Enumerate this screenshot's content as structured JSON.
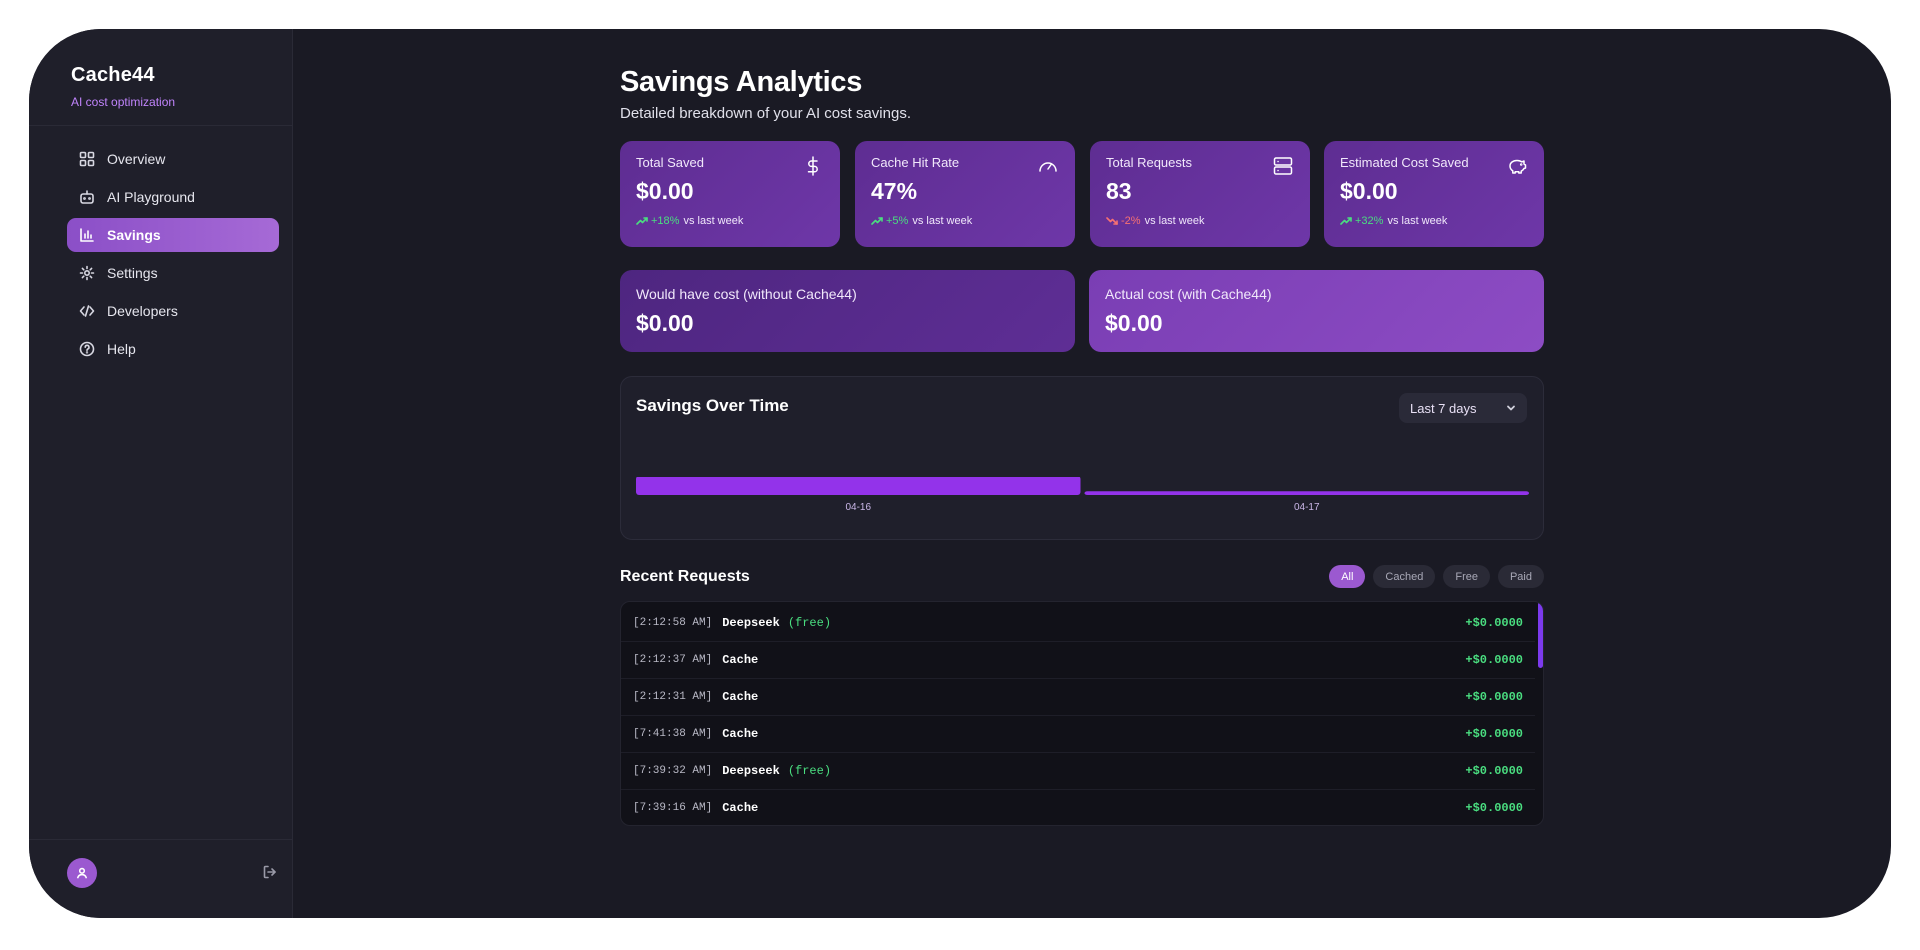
{
  "app": {
    "name": "Cache44",
    "tagline": "AI cost optimization"
  },
  "sidebar": {
    "items": [
      {
        "label": "Overview",
        "icon": "grid-icon",
        "active": false
      },
      {
        "label": "AI Playground",
        "icon": "bot-icon",
        "active": false
      },
      {
        "label": "Savings",
        "icon": "bar-chart-icon",
        "active": true
      },
      {
        "label": "Settings",
        "icon": "gear-icon",
        "active": false
      },
      {
        "label": "Developers",
        "icon": "code-icon",
        "active": false
      },
      {
        "label": "Help",
        "icon": "help-circle-icon",
        "active": false
      }
    ]
  },
  "page": {
    "title": "Savings Analytics",
    "subtitle": "Detailed breakdown of your AI cost savings."
  },
  "stats": [
    {
      "label": "Total Saved",
      "value": "$0.00",
      "trend": "+18%",
      "trend_dir": "up",
      "trend_suffix": "vs last week",
      "icon": "dollar-icon"
    },
    {
      "label": "Cache Hit Rate",
      "value": "47%",
      "trend": "+5%",
      "trend_dir": "up",
      "trend_suffix": "vs last week",
      "icon": "gauge-icon"
    },
    {
      "label": "Total Requests",
      "value": "83",
      "trend": "-2%",
      "trend_dir": "down",
      "trend_suffix": "vs last week",
      "icon": "server-icon"
    },
    {
      "label": "Estimated Cost Saved",
      "value": "$0.00",
      "trend": "+32%",
      "trend_dir": "up",
      "trend_suffix": "vs last week",
      "icon": "piggy-bank-icon"
    }
  ],
  "comparison": {
    "without": {
      "label": "Would have cost (without Cache44)",
      "value": "$0.00"
    },
    "with": {
      "label": "Actual cost (with Cache44)",
      "value": "$0.00"
    }
  },
  "chart": {
    "title": "Savings Over Time",
    "range": "Last 7 days"
  },
  "chart_data": {
    "type": "bar",
    "categories": [
      "04-16",
      "04-17"
    ],
    "values": [
      1,
      0.2
    ],
    "title": "Savings Over Time",
    "xlabel": "",
    "ylabel": "",
    "bar_color": "#9333ea"
  },
  "recent": {
    "title": "Recent Requests",
    "filters": [
      {
        "label": "All",
        "active": true
      },
      {
        "label": "Cached",
        "active": false
      },
      {
        "label": "Free",
        "active": false
      },
      {
        "label": "Paid",
        "active": false
      }
    ],
    "rows": [
      {
        "time": "[2:12:58 AM]",
        "source": "Deepseek",
        "tag": "(free)",
        "amount": "+$0.0000"
      },
      {
        "time": "[2:12:37 AM]",
        "source": "Cache",
        "tag": "",
        "amount": "+$0.0000"
      },
      {
        "time": "[2:12:31 AM]",
        "source": "Cache",
        "tag": "",
        "amount": "+$0.0000"
      },
      {
        "time": "[7:41:38 AM]",
        "source": "Cache",
        "tag": "",
        "amount": "+$0.0000"
      },
      {
        "time": "[7:39:32 AM]",
        "source": "Deepseek",
        "tag": "(free)",
        "amount": "+$0.0000"
      },
      {
        "time": "[7:39:16 AM]",
        "source": "Cache",
        "tag": "",
        "amount": "+$0.0000"
      }
    ]
  },
  "colors": {
    "accent": "#9b59d0",
    "positive": "#4ade80",
    "negative": "#f87171",
    "background": "#1a1a24"
  }
}
